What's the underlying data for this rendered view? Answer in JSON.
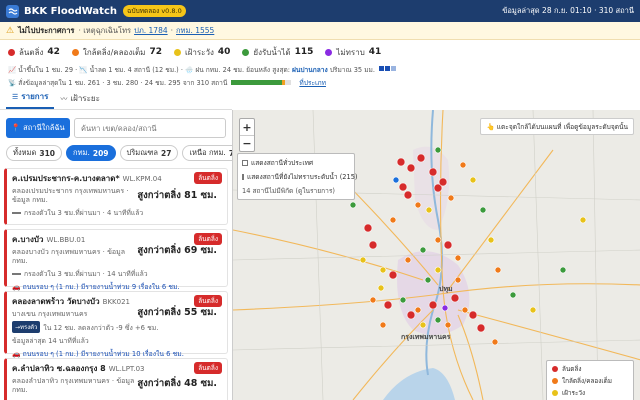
{
  "header": {
    "title": "BKK FloodWatch",
    "version": "ฉบับทดลอง v0.8.0",
    "updated": "ข้อมูลล่าสุด 28 ก.ย. 01:10 · 310 สถานี"
  },
  "alert": {
    "title": "ไม่ไปประกาศการ",
    "text": "· เหตุฉุกเฉินโทร",
    "link1": "ปภ. 1784",
    "sep": "·",
    "link2": "กทม. 1555"
  },
  "stats": [
    {
      "label": "ล้นตลิ่ง",
      "value": "42",
      "color": "#d62b2b"
    },
    {
      "label": "ใกล้ตลิ่ง/คลองเต็ม",
      "value": "72",
      "color": "#f07a1a"
    },
    {
      "label": "เฝ้าระวัง",
      "value": "40",
      "color": "#e8c21a"
    },
    {
      "label": "ยังรับน้ำได้",
      "value": "115",
      "color": "#3c9a3c"
    },
    {
      "label": "ไม่ทราบ",
      "value": "41",
      "color": "#8a2be2"
    }
  ],
  "info1": {
    "a": "📈 น้ำขึ้นใน 1 ชม. 29 · 📉 น้ำลด 1 ชม. 4 สถานี (12 ชม.) · 🌧️ ฝน กทม. 24 ชม. ย้อนหลัง สูงสุด:",
    "place": "ฝนปานกลาง",
    "b": "ปริมาณ 35 มม."
  },
  "info2": {
    "a": "📡 สั่งข้อมูลล่าสุดใน 1 ชม. 261 · 3 ชม. 280 · 24 ชม. 295 จาก 310 สถานี",
    "link": "ที่ประเภท",
    "green": 0.84,
    "orange": 0.06
  },
  "tabs": {
    "list": "รายการ",
    "trend": "เฝ้าระยะ"
  },
  "sidebar": {
    "near_button": "📍 สถานีใกล้ฉัน",
    "search_placeholder": "ค้นหา เขต/คลอง/สถานี",
    "filters": [
      {
        "label": "ทั้งหมด",
        "count": "310"
      },
      {
        "label": "กทม.",
        "count": "209"
      },
      {
        "label": "ปริมณฑล",
        "count": "27"
      },
      {
        "label": "เหนือ กทม.",
        "count": "74"
      }
    ]
  },
  "cards": [
    {
      "name": "ค.เปรมประชากร-ค.บางตลาด*",
      "code": "WL.KPM.04",
      "badge": "ล้นตลิ่ง",
      "loc": "คลองเปรมประชากร กรุงเทพมหานคร · ข้อมูล กทม.",
      "level": "สูงกว่าตลิ่ง 81 ซม.",
      "updated": "กรองตัวใน 3 ชม.ที่ผ่านมา · 4 นาทีที่แล้ว",
      "trend": "",
      "rain": ""
    },
    {
      "name": "ค.บางบัว",
      "code": "WL.BBU.01",
      "badge": "ล้นตลิ่ง",
      "loc": "คลองบางบัว กรุงเทพมหานคร · ข้อมูล กทม.",
      "level": "สูงกว่าตลิ่ง 69 ซม.",
      "updated": "กรองตัวใน 3 ชม.ที่ผ่านมา · 14 นาทีที่แล้ว",
      "trend": "",
      "rain": "🚗 ถนนรอบ ๆ (1 กม.) มีรายงานน้ำท่วม 9 เรื่องใน 6 ชม."
    },
    {
      "name": "คลองลาดพร้าว วัดบางบัว",
      "code": "BKK021",
      "badge": "ล้นตลิ่ง",
      "loc": "บางเขน กรุงเทพมหานคร",
      "level": "สูงกว่าตลิ่ง 55 ซม.",
      "updated": "ใน 12 ชม. ลดลงกว่าตัว -9 ซึ่ง +6 ชม.",
      "trend": "→ทรงตัว",
      "updated2": "ข้อมูลล่าสุด 14 นาทีที่แล้ว",
      "rain": "🚗 ถนนรอบ ๆ (1 กม.) มีรายงานน้ำท่วม 10 เรื่องใน 6 ชม."
    },
    {
      "name": "ค.ลำปลาทิว ซ.ฉลองกรุง 8",
      "code": "WL.LPT.03",
      "badge": "ล้นตลิ่ง",
      "loc": "คลองลำปลาทิว กรุงเทพมหานคร · ข้อมูล กทม.",
      "level": "สูงกว่าตลิ่ง 48 ซม.",
      "updated": "",
      "trend": "",
      "rain": ""
    }
  ],
  "map": {
    "options": [
      "แสดงสถานีทั่วประเทศ",
      "แสดงสถานีที่ยังไม่ทราบระดับน้ำ (215)"
    ],
    "note": "14 สถานีไม่มีพิกัด (ดูในรายการ)",
    "hint": "👆 แตะจุดใกล้ได้บนแผนที่ เพื่อดูข้อมูลระดับจุดนั้น",
    "city_label": "กรุงเทพมหานคร",
    "north_label": "ปทุม",
    "legend": [
      {
        "label": "ล้นตลิ่ง",
        "color": "#d62b2b"
      },
      {
        "label": "ใกล้ตลิ่ง/คลองเต็ม",
        "color": "#f07a1a"
      },
      {
        "label": "เฝ้าระวัง",
        "color": "#e8c21a"
      },
      {
        "label": "ยังรับน้ำได้",
        "color": "#3c9a3c"
      }
    ],
    "zoom_in": "+",
    "zoom_out": "−"
  }
}
